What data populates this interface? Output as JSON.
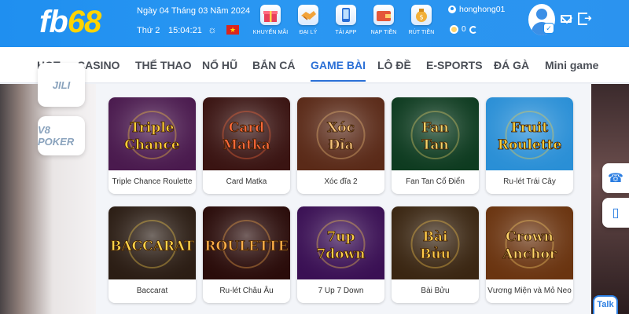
{
  "header": {
    "logo_prefix": "fb",
    "logo_number": "68",
    "date": "Ngày 04 Tháng 03 Năm 2024",
    "weekday": "Thứ 2",
    "time": "15:04:21",
    "quick_actions": [
      {
        "label": "KHUYẾN MÃI",
        "icon": "gift-icon"
      },
      {
        "label": "ĐẠI LÝ",
        "icon": "handshake-icon"
      },
      {
        "label": "TẢI APP",
        "icon": "phone-icon"
      },
      {
        "label": "NẠP TIỀN",
        "icon": "wallet-icon"
      },
      {
        "label": "RÚT TIỀN",
        "icon": "money-bag-icon"
      }
    ],
    "username": "honghong01",
    "balance": "0"
  },
  "nav": {
    "items": [
      "HOT",
      "CASINO",
      "THỂ THAO",
      "NỔ HŨ",
      "BẮN CÁ",
      "GAME BÀI",
      "LÔ ĐỀ",
      "E-SPORTS",
      "ĐÁ GÀ",
      "Mini game"
    ],
    "active": "GAME BÀI"
  },
  "side": {
    "tiles": [
      "JILI",
      "V8 POKER"
    ],
    "talk_label": "Talk"
  },
  "games": [
    {
      "name": "Triple Chance Roulette",
      "art": "Triple Chance",
      "bg": "#4a1a4e",
      "accent": "#ffcf3a"
    },
    {
      "name": "Card Matka",
      "art": "Card Matka",
      "bg": "#3a1412",
      "accent": "#ff6a3a"
    },
    {
      "name": "Xóc đĩa 2",
      "art": "Xóc Đĩa",
      "bg": "#5a2a18",
      "accent": "#f4c27a"
    },
    {
      "name": "Fan Tan Cổ Điển",
      "art": "Fan Tan",
      "bg": "#0e3b20",
      "accent": "#f2d46a"
    },
    {
      "name": "Ru-lét Trái Cây",
      "art": "Fruit Roulette",
      "bg": "#2a8fd6",
      "accent": "#ffd23a"
    },
    {
      "name": "Baccarat",
      "art": "BACCARAT",
      "bg": "#2b1d14",
      "accent": "#ffd54a"
    },
    {
      "name": "Ru-lét Châu Âu",
      "art": "ROULETTE",
      "bg": "#2a0c0a",
      "accent": "#ffb04a"
    },
    {
      "name": "7 Up 7 Down",
      "art": "7up 7down",
      "bg": "#3a1054",
      "accent": "#ffd14a"
    },
    {
      "name": "Bài Bửu",
      "art": "Bài Bửu",
      "bg": "#3a2612",
      "accent": "#ffcc4a"
    },
    {
      "name": "Vương Miện và Mỏ Neo",
      "art": "Crown Anchor",
      "bg": "#6a3410",
      "accent": "#ffd56a"
    }
  ]
}
